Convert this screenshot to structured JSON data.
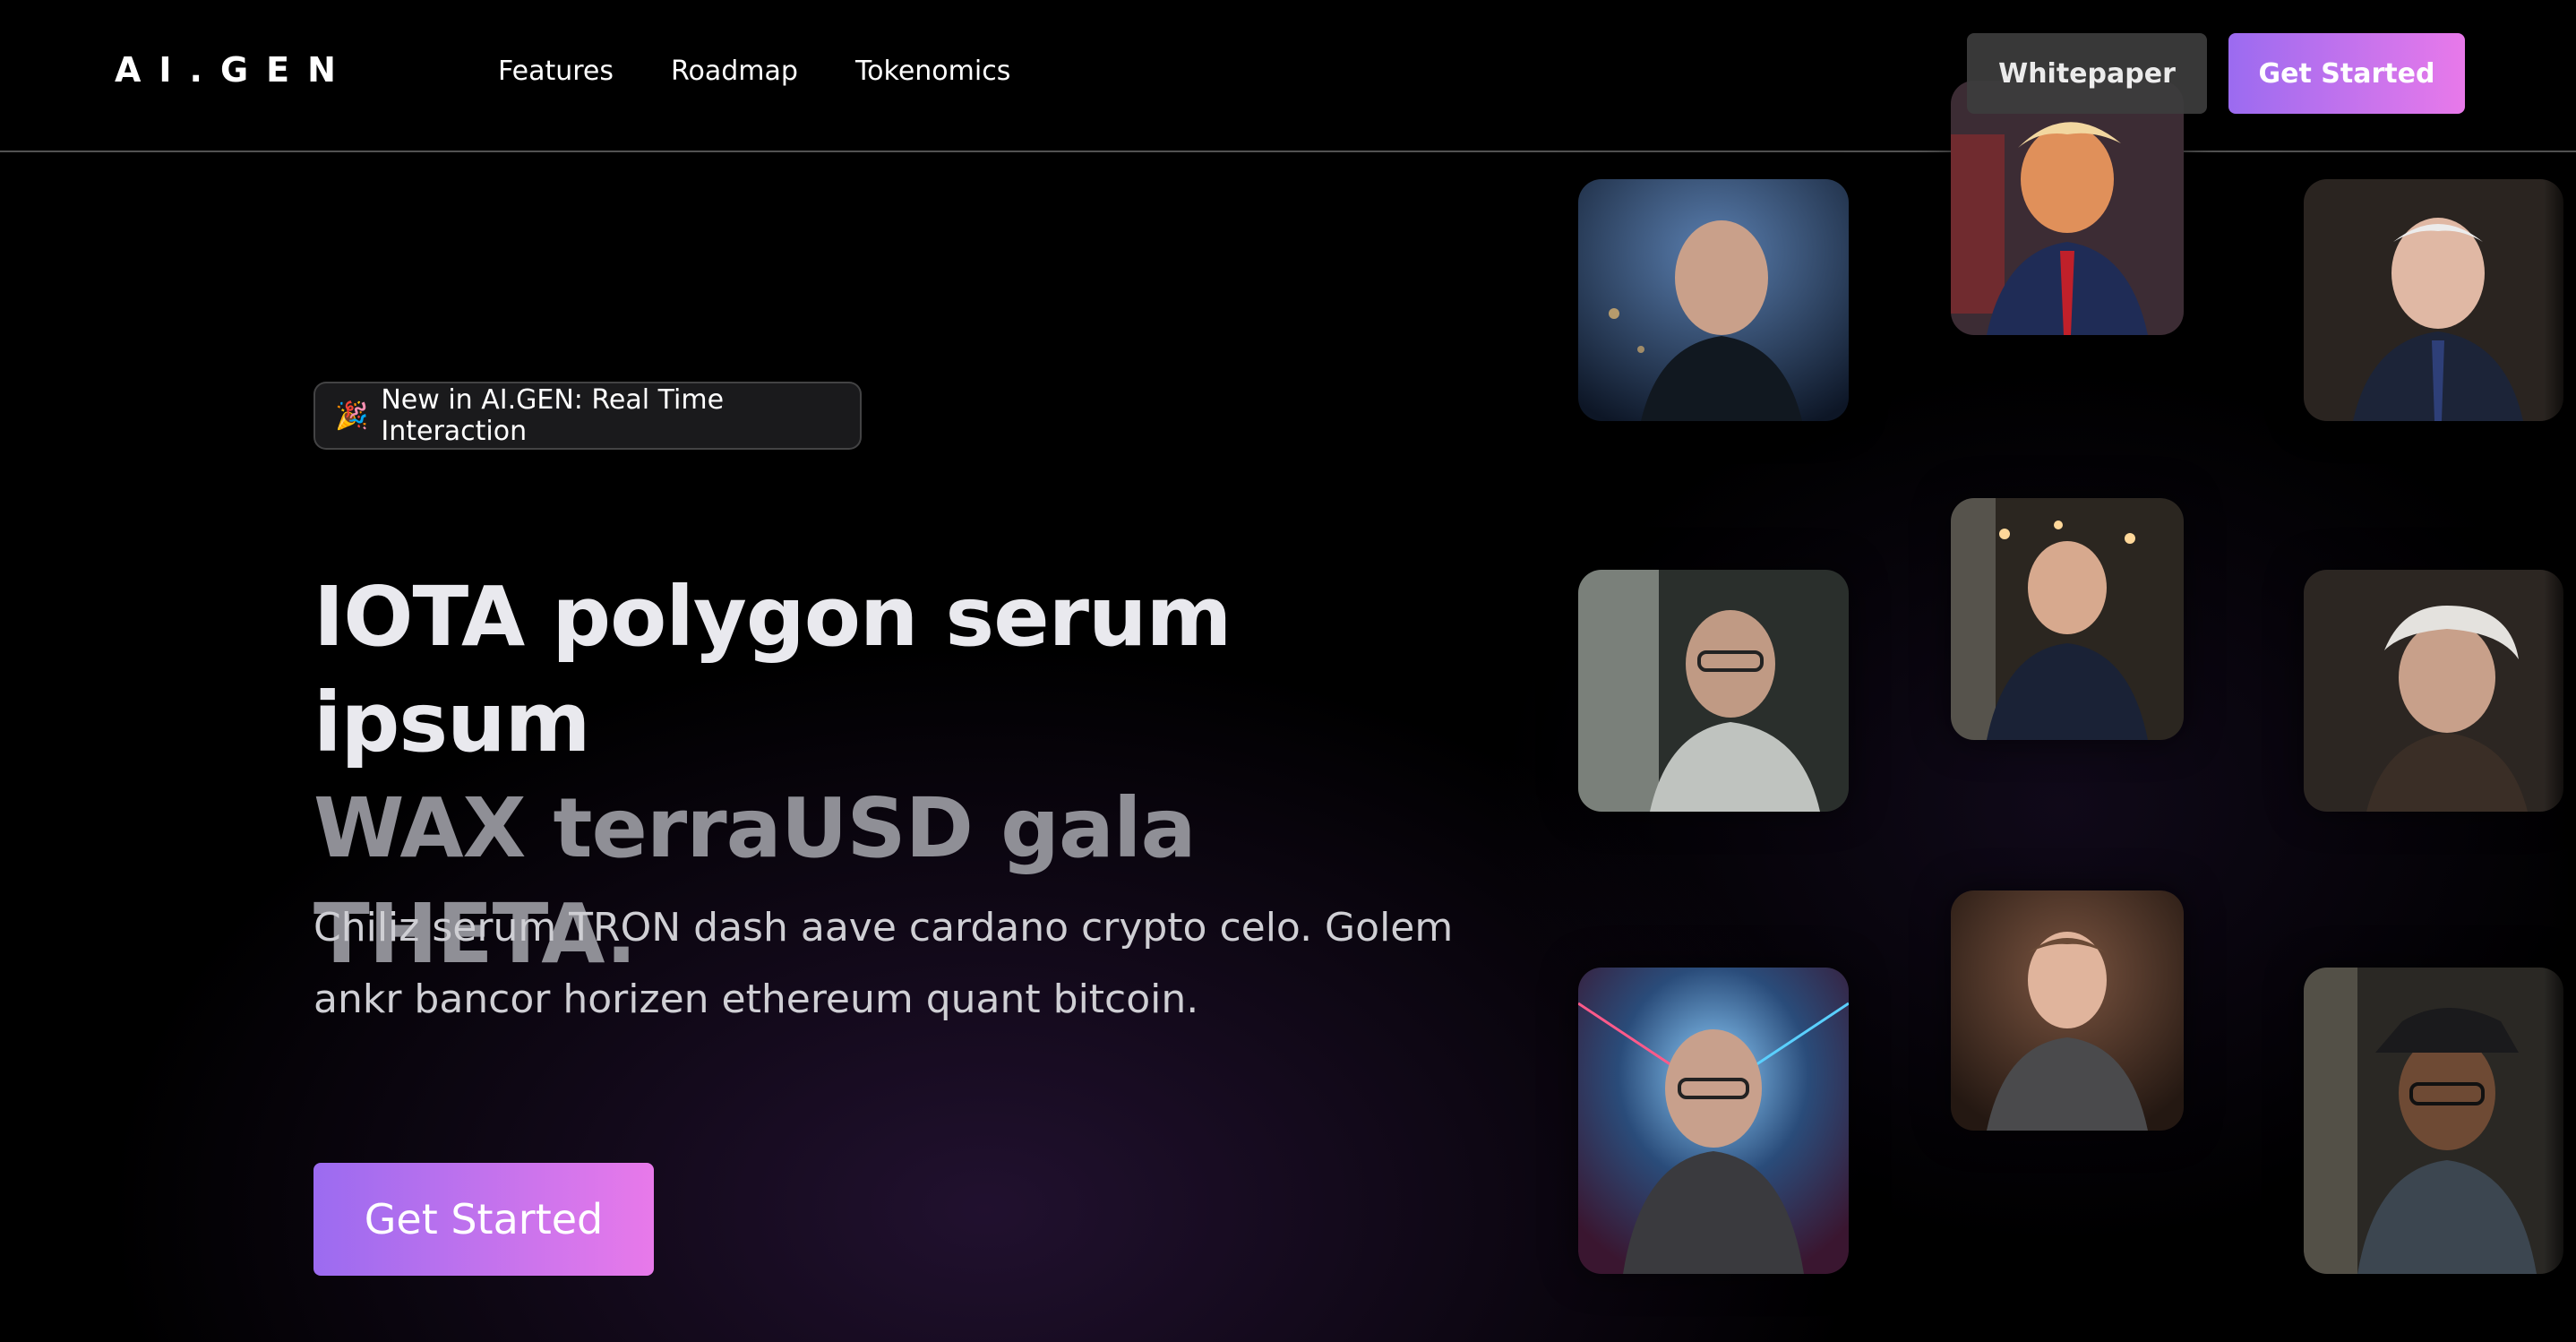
{
  "header": {
    "logo": "AI.GEN",
    "nav": [
      {
        "label": "Features"
      },
      {
        "label": "Roadmap"
      },
      {
        "label": "Tokenomics"
      }
    ],
    "whitepaper_label": "Whitepaper",
    "get_started_label": "Get Started"
  },
  "hero": {
    "badge_text": "New in AI.GEN: Real Time Interaction",
    "badge_icon": "party-popper-icon",
    "headline_line1": "IOTA polygon serum ipsum",
    "headline_line2": "WAX terraUSD gala THETA.",
    "subtext": "Chiliz serum TRON dash aave cardano crypto celo. Golem ankr bancor horizen ethereum quant bitcoin.",
    "cta_label": "Get Started"
  },
  "portraits": [
    {
      "name": "portrait-bald-suit",
      "bg": "#2a3a5c"
    },
    {
      "name": "portrait-blonde-suit",
      "bg": "#3a2f3a"
    },
    {
      "name": "portrait-white-hair-suit",
      "bg": "#2e2a26"
    },
    {
      "name": "portrait-glasses-window",
      "bg": "#2c2e2c"
    },
    {
      "name": "portrait-tshirt-cafe",
      "bg": "#2d2a24"
    },
    {
      "name": "portrait-white-hair-elder",
      "bg": "#2a2623"
    },
    {
      "name": "portrait-glasses-neon",
      "bg": "#1f3550"
    },
    {
      "name": "portrait-young-tshirt",
      "bg": "#3a2a22"
    },
    {
      "name": "portrait-hat-glasses",
      "bg": "#2b2a26"
    }
  ],
  "colors": {
    "accent_start": "#9b6bf0",
    "accent_end": "#e879ea",
    "background": "#000000"
  }
}
